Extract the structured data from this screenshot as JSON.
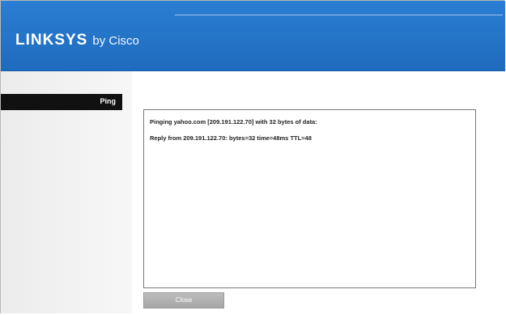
{
  "header": {
    "brand": "LINKSYS",
    "byline": "by Cisco"
  },
  "sidebar": {
    "active_item": "Ping"
  },
  "ping_result": {
    "lines": [
      "Pinging yahoo.com [209.191.122.70] with 32 bytes of data:",
      "Reply from 209.191.122.70: bytes=32 time=48ms TTL=48"
    ]
  },
  "buttons": {
    "close_label": "Close"
  }
}
